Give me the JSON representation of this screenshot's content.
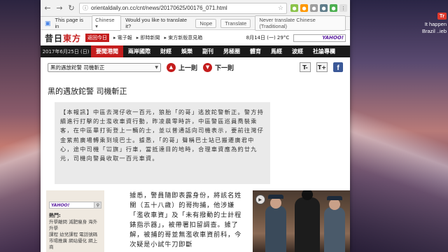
{
  "browser": {
    "url_prefix": "ⓘ",
    "url": "orientaldaily.on.cc/cnt/news/20170625/00176_071.html"
  },
  "translate_bar": {
    "prefix": "This page is in",
    "language": "Chinese",
    "question": "Would you like to translate it?",
    "nope": "Nope",
    "translate": "Translate",
    "never": "Never translate Chinese (Traditional)"
  },
  "site": {
    "logo_a": "昔日",
    "logo_b": "東方",
    "today": "返回今日",
    "link1": "電子報",
    "link2": "即時新聞",
    "link3": "東方新版意見箱",
    "date_weather": "8月14日 (一) 29°C",
    "search_label": "YAHOO!"
  },
  "nav": {
    "date": "2017年6月25日 (日)",
    "items": [
      "要聞港聞",
      "兩岸國際",
      "財經",
      "娛樂",
      "副刊",
      "男極圈",
      "體育",
      "馬經",
      "波經",
      "社論專欄"
    ]
  },
  "toolbar": {
    "select_value": "黑的遇放鉈警 司機斬正",
    "prev": "上一則",
    "next": "下一則",
    "font_small": "T-",
    "font_large": "T+",
    "fb": "f"
  },
  "article": {
    "title": "黑的遇放鉈警 司機斬正",
    "body": "【本報訊】中區去灣仔收一百元，狼胎「的哥」逃放鉈警斬正。警方持續進行打擊的士濫收車資行動，昨凌晨零時許，中區警區巡員喬裝乘客，在中區畢打街登上一輛的士，並以普通話向司機表示，要前往灣仔金紫荊廣場轉乘到境巴士。據悉，「的哥」聲稱巴士站已搬遷廣君中心，途中司機「冚旗」行車，當抵達目的地時，合理車資應為約廿九元，司機向警員收取一百元車資。",
    "continued": "據悉，警員隨即表露身份，將該名姓關（五十八歲）的哥拘捕，他涉嫌「濫收車資」及「未有撥動的士計程錶指示器」，被帶署扣留調查。據了解，被捕的哥並無濫收車資前科，今次疑是小試牛刀即斷"
  },
  "sidebar": {
    "search_label": "YAHOO!",
    "hot_title": "熱門:",
    "lines": [
      "升學離問 減肥瘦身 海外升學",
      "課程 幼兒課程 電話號碼",
      "市場推廣 網站優化 網上商"
    ]
  },
  "photo": {
    "play": "▶"
  },
  "desktop": {
    "badge": "Tr",
    "notice1": "It happen",
    "notice2": "Brazil ..ieb"
  }
}
